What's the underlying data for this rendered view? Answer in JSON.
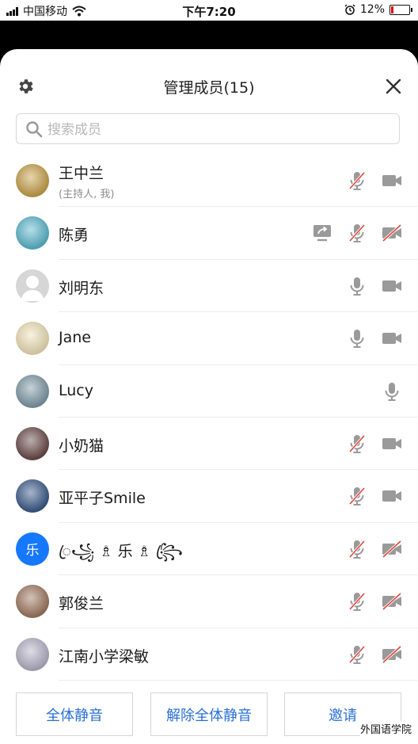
{
  "status_bar": {
    "carrier": "中国移动",
    "time": "下午7:20",
    "battery": "12%",
    "battery_level": 0.12
  },
  "header": {
    "title": "管理成员(15)"
  },
  "search": {
    "placeholder": "搜索成员"
  },
  "members": [
    {
      "name": "王中兰",
      "sub": "(主持人, 我)",
      "avatar_bg": "#c9a24a",
      "screen_share": false,
      "mic_muted": true,
      "video_off": false,
      "has_video": true
    },
    {
      "name": "陈勇",
      "avatar_bg": "#5bb8cf",
      "screen_share": true,
      "mic_muted": true,
      "video_off": true,
      "has_video": true
    },
    {
      "name": "刘明东",
      "avatar_bg": "#d6d6d6",
      "screen_share": false,
      "mic_muted": false,
      "video_off": false,
      "has_video": true
    },
    {
      "name": "Jane",
      "avatar_bg": "#f0e2b8",
      "screen_share": false,
      "mic_muted": false,
      "video_off": false,
      "has_video": true
    },
    {
      "name": "Lucy",
      "avatar_bg": "#7f9aa8",
      "screen_share": false,
      "mic_muted": false,
      "video_off": false,
      "has_video": false
    },
    {
      "name": "小奶猫",
      "avatar_bg": "#6b4a4a",
      "screen_share": false,
      "mic_muted": true,
      "video_off": false,
      "has_video": true
    },
    {
      "name": "亚平子Smile",
      "avatar_bg": "#3b5a8a",
      "screen_share": false,
      "mic_muted": true,
      "video_off": false,
      "has_video": true
    },
    {
      "name": "ꦿ꧁ ♗ 乐 ♗ ꧂ꦿ",
      "avatar_text": "乐",
      "avatar_bg": "#1677ff",
      "screen_share": false,
      "mic_muted": true,
      "video_off": true,
      "has_video": true
    },
    {
      "name": "郭俊兰",
      "avatar_bg": "#a07860",
      "screen_share": false,
      "mic_muted": true,
      "video_off": true,
      "has_video": true
    },
    {
      "name": "江南小学梁敏",
      "avatar_bg": "#b7b3c8",
      "screen_share": false,
      "mic_muted": true,
      "video_off": true,
      "has_video": true
    }
  ],
  "footer": {
    "mute_all": "全体静音",
    "unmute_all": "解除全体静音",
    "invite": "邀请"
  },
  "watermark": "外国语学院",
  "colors": {
    "accent": "#2a6fd6",
    "icon_gray": "#9a9a9a",
    "muted_red": "#e0473e"
  }
}
